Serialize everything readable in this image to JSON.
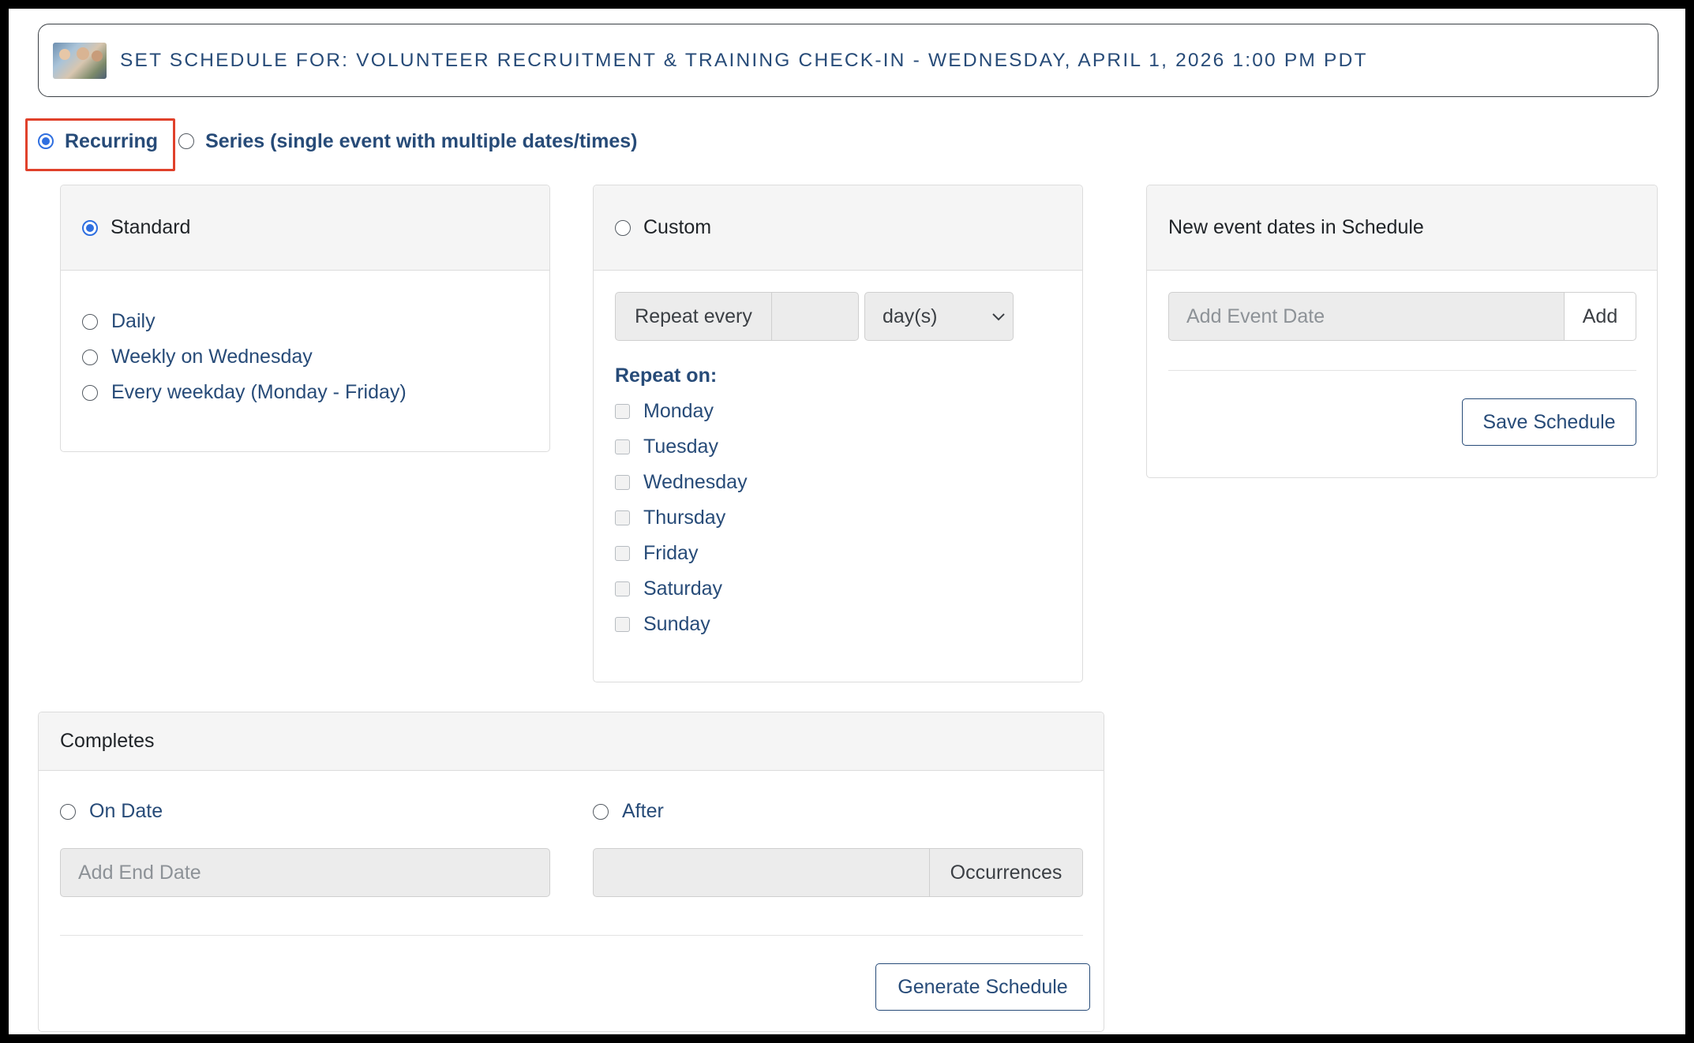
{
  "header": {
    "title": "SET SCHEDULE FOR: VOLUNTEER RECRUITMENT & TRAINING CHECK-IN - WEDNESDAY, APRIL 1, 2026 1:00 PM PDT"
  },
  "mode": {
    "recurring_label": "Recurring",
    "series_label": "Series (single event with multiple dates/times)"
  },
  "standard": {
    "header": "Standard",
    "options": [
      "Daily",
      "Weekly on Wednesday",
      "Every weekday (Monday - Friday)"
    ]
  },
  "custom": {
    "header": "Custom",
    "repeat_every_label": "Repeat every",
    "repeat_every_value": "",
    "unit_selected": "day(s)",
    "repeat_on_label": "Repeat on:",
    "days": [
      "Monday",
      "Tuesday",
      "Wednesday",
      "Thursday",
      "Friday",
      "Saturday",
      "Sunday"
    ]
  },
  "new_dates": {
    "header": "New event dates in Schedule",
    "input_placeholder": "Add Event Date",
    "add_label": "Add",
    "save_label": "Save Schedule"
  },
  "completes": {
    "header": "Completes",
    "on_date_label": "On Date",
    "end_date_placeholder": "Add End Date",
    "after_label": "After",
    "occurrences_value": "",
    "occurrences_label": "Occurrences",
    "generate_label": "Generate Schedule"
  },
  "colors": {
    "accent": "#274b78",
    "radio_checked": "#2f6fe0",
    "highlight": "#e0412b"
  }
}
